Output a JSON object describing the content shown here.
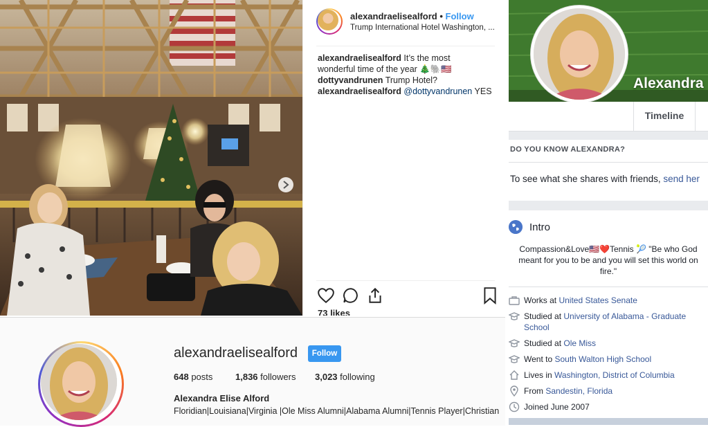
{
  "post": {
    "username": "alexandraelisealford",
    "separator": "•",
    "follow": "Follow",
    "location": "Trump International Hotel Washington, ...",
    "comments": [
      {
        "user": "alexandraelisealford",
        "text": "It’s the most",
        "text2": "wonderful time of the year 🎄🐘🇺🇸"
      },
      {
        "user": "dottyvandrunen",
        "text": "Trump Hotel?"
      },
      {
        "user": "alexandraelisealford",
        "mention": "@dottyvandrunen",
        "text": "YES"
      }
    ],
    "likes": "73 likes"
  },
  "profile": {
    "handle": "alexandraelisealford",
    "follow_button": "Follow",
    "posts_count": "648",
    "posts_label": "posts",
    "followers_count": "1,836",
    "followers_label": "followers",
    "following_count": "3,023",
    "following_label": "following",
    "full_name": "Alexandra Elise Alford",
    "bio": "Floridian|Louisiana|Virginia |Ole Miss Alumni|Alabama Alumni|Tennis Player|Christian"
  },
  "facebook": {
    "cover_name": "Alexandra",
    "tab": "Timeline",
    "know_heading": "DO YOU KNOW ALEXANDRA?",
    "see_text": "To see what she shares with friends, ",
    "see_link": "send her",
    "intro_title": "Intro",
    "intro_bio": "Compassion&Love🇺🇸❤️Tennis 🎾 \"Be who God meant for you to be and you will set this world on fire.\"",
    "details": [
      {
        "icon": "briefcase-icon",
        "prefix": "Works at ",
        "link": "United States Senate"
      },
      {
        "icon": "graduation-cap-icon",
        "prefix": "Studied at ",
        "link": "University of Alabama - Graduate School"
      },
      {
        "icon": "graduation-cap-icon",
        "prefix": "Studied at ",
        "link": "Ole Miss"
      },
      {
        "icon": "graduation-cap-icon",
        "prefix": "Went to ",
        "link": "South Walton High School"
      },
      {
        "icon": "home-icon",
        "prefix": "Lives in ",
        "link": "Washington, District of Columbia"
      },
      {
        "icon": "location-pin-icon",
        "prefix": "From ",
        "link": "Sandestin, Florida"
      },
      {
        "icon": "clock-icon",
        "prefix": "Joined June 2007",
        "link": ""
      }
    ]
  },
  "colors": {
    "instagram_blue": "#3897f0",
    "facebook_link": "#385898",
    "facebook_gray": "#e9ebee"
  }
}
